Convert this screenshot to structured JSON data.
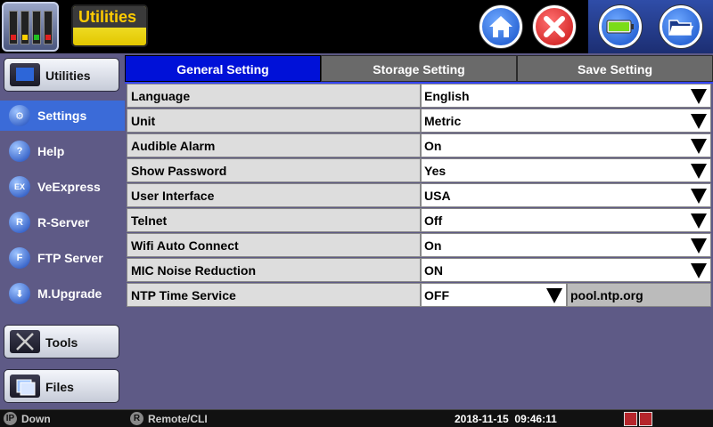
{
  "header": {
    "title": "Utilities",
    "icons": {
      "logo": "instrument-logo-icon",
      "home": "home-icon",
      "close": "close-icon",
      "battery": "battery-icon",
      "folder": "folder-icon"
    },
    "colors": {
      "title_bg": "#fbf24a",
      "home": "#1450c8",
      "close": "#c81414"
    }
  },
  "sidebar": {
    "header_label": "Utilities",
    "items": [
      {
        "label": "Settings",
        "icon": "settings-icon",
        "active": true
      },
      {
        "label": "Help",
        "icon": "help-icon",
        "active": false
      },
      {
        "label": "VeExpress",
        "icon": "veexpress-icon",
        "active": false
      },
      {
        "label": "R-Server",
        "icon": "r-server-icon",
        "active": false
      },
      {
        "label": "FTP Server",
        "icon": "ftp-server-icon",
        "active": false
      },
      {
        "label": "M.Upgrade",
        "icon": "upgrade-icon",
        "active": false
      }
    ],
    "tools_label": "Tools",
    "files_label": "Files"
  },
  "tabs": [
    {
      "label": "General Setting",
      "active": true
    },
    {
      "label": "Storage Setting",
      "active": false
    },
    {
      "label": "Save Setting",
      "active": false
    }
  ],
  "settings": [
    {
      "label": "Language",
      "value": "English"
    },
    {
      "label": "Unit",
      "value": "Metric"
    },
    {
      "label": "Audible Alarm",
      "value": "On"
    },
    {
      "label": "Show Password",
      "value": "Yes"
    },
    {
      "label": "User Interface",
      "value": "USA"
    },
    {
      "label": "Telnet",
      "value": "Off"
    },
    {
      "label": "Wifi Auto Connect",
      "value": "On"
    },
    {
      "label": "MIC Noise Reduction",
      "value": "ON"
    },
    {
      "label": "NTP Time Service",
      "value": "OFF",
      "server": "pool.ntp.org"
    }
  ],
  "status": {
    "ip_badge": "IP",
    "ip_state": "Down",
    "remote_badge": "R",
    "remote_label": "Remote/CLI",
    "datetime": "2018-11-15  09:46:11"
  },
  "colors": {
    "accent_tab": "#0011d8",
    "sidebar_active": "#3b6bd8",
    "background": "#5e5a86"
  }
}
